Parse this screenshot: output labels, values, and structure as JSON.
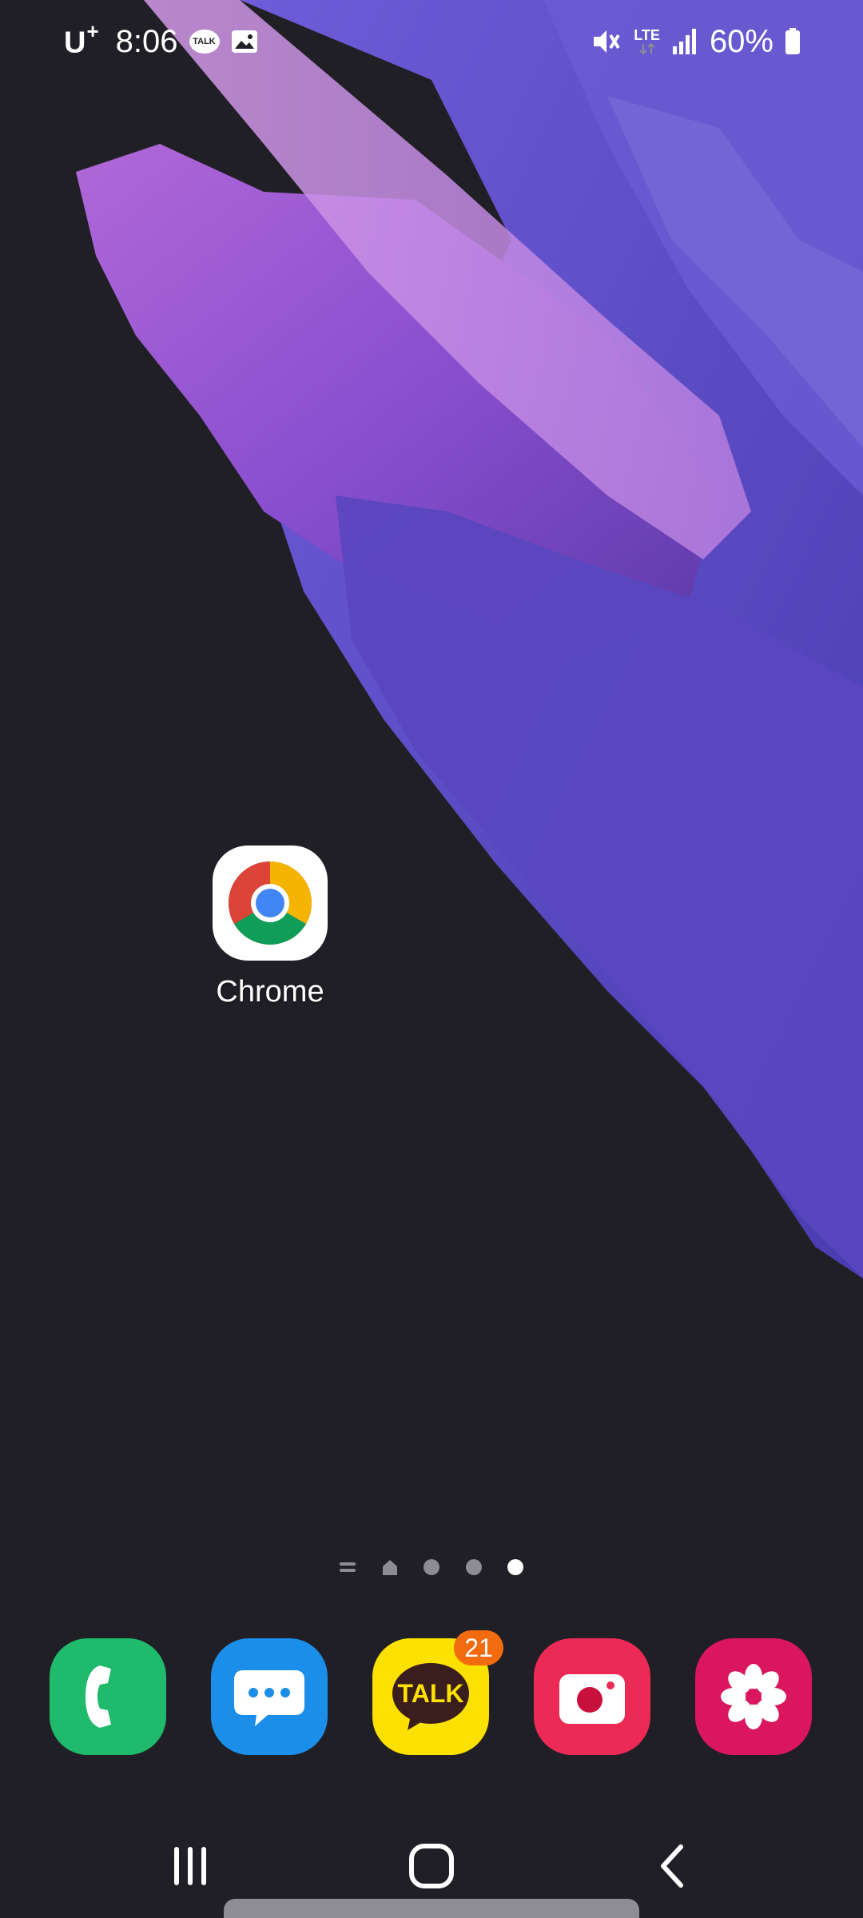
{
  "status_bar": {
    "carrier": "U",
    "carrier_suffix": "+",
    "time": "8:06",
    "talk_notification": "TALK",
    "network": "LTE",
    "battery": "60%",
    "icons": [
      "kakaotalk-icon",
      "gallery-icon",
      "mute-icon",
      "signal-icon",
      "battery-icon"
    ]
  },
  "home_screen": {
    "apps": [
      {
        "label": "Chrome",
        "icon": "chrome-icon"
      }
    ],
    "page_indicator": {
      "items": [
        "list-indicator",
        "home-indicator",
        "page-dot",
        "page-dot",
        "page-dot"
      ],
      "active_index": 4
    }
  },
  "dock": {
    "apps": [
      {
        "name": "phone",
        "icon": "phone-icon",
        "color": "#1fba6b"
      },
      {
        "name": "messages",
        "icon": "message-icon",
        "color": "#1a8ee8"
      },
      {
        "name": "kakaotalk",
        "icon": "kakaotalk-icon",
        "label": "TALK",
        "badge": "21",
        "color": "#fae100"
      },
      {
        "name": "camera",
        "icon": "camera-icon",
        "color": "#ec2a56"
      },
      {
        "name": "gallery",
        "icon": "flower-icon",
        "color": "#d9165e"
      }
    ]
  },
  "nav_bar": {
    "buttons": [
      "recent-apps-icon",
      "home-icon",
      "back-icon"
    ]
  }
}
